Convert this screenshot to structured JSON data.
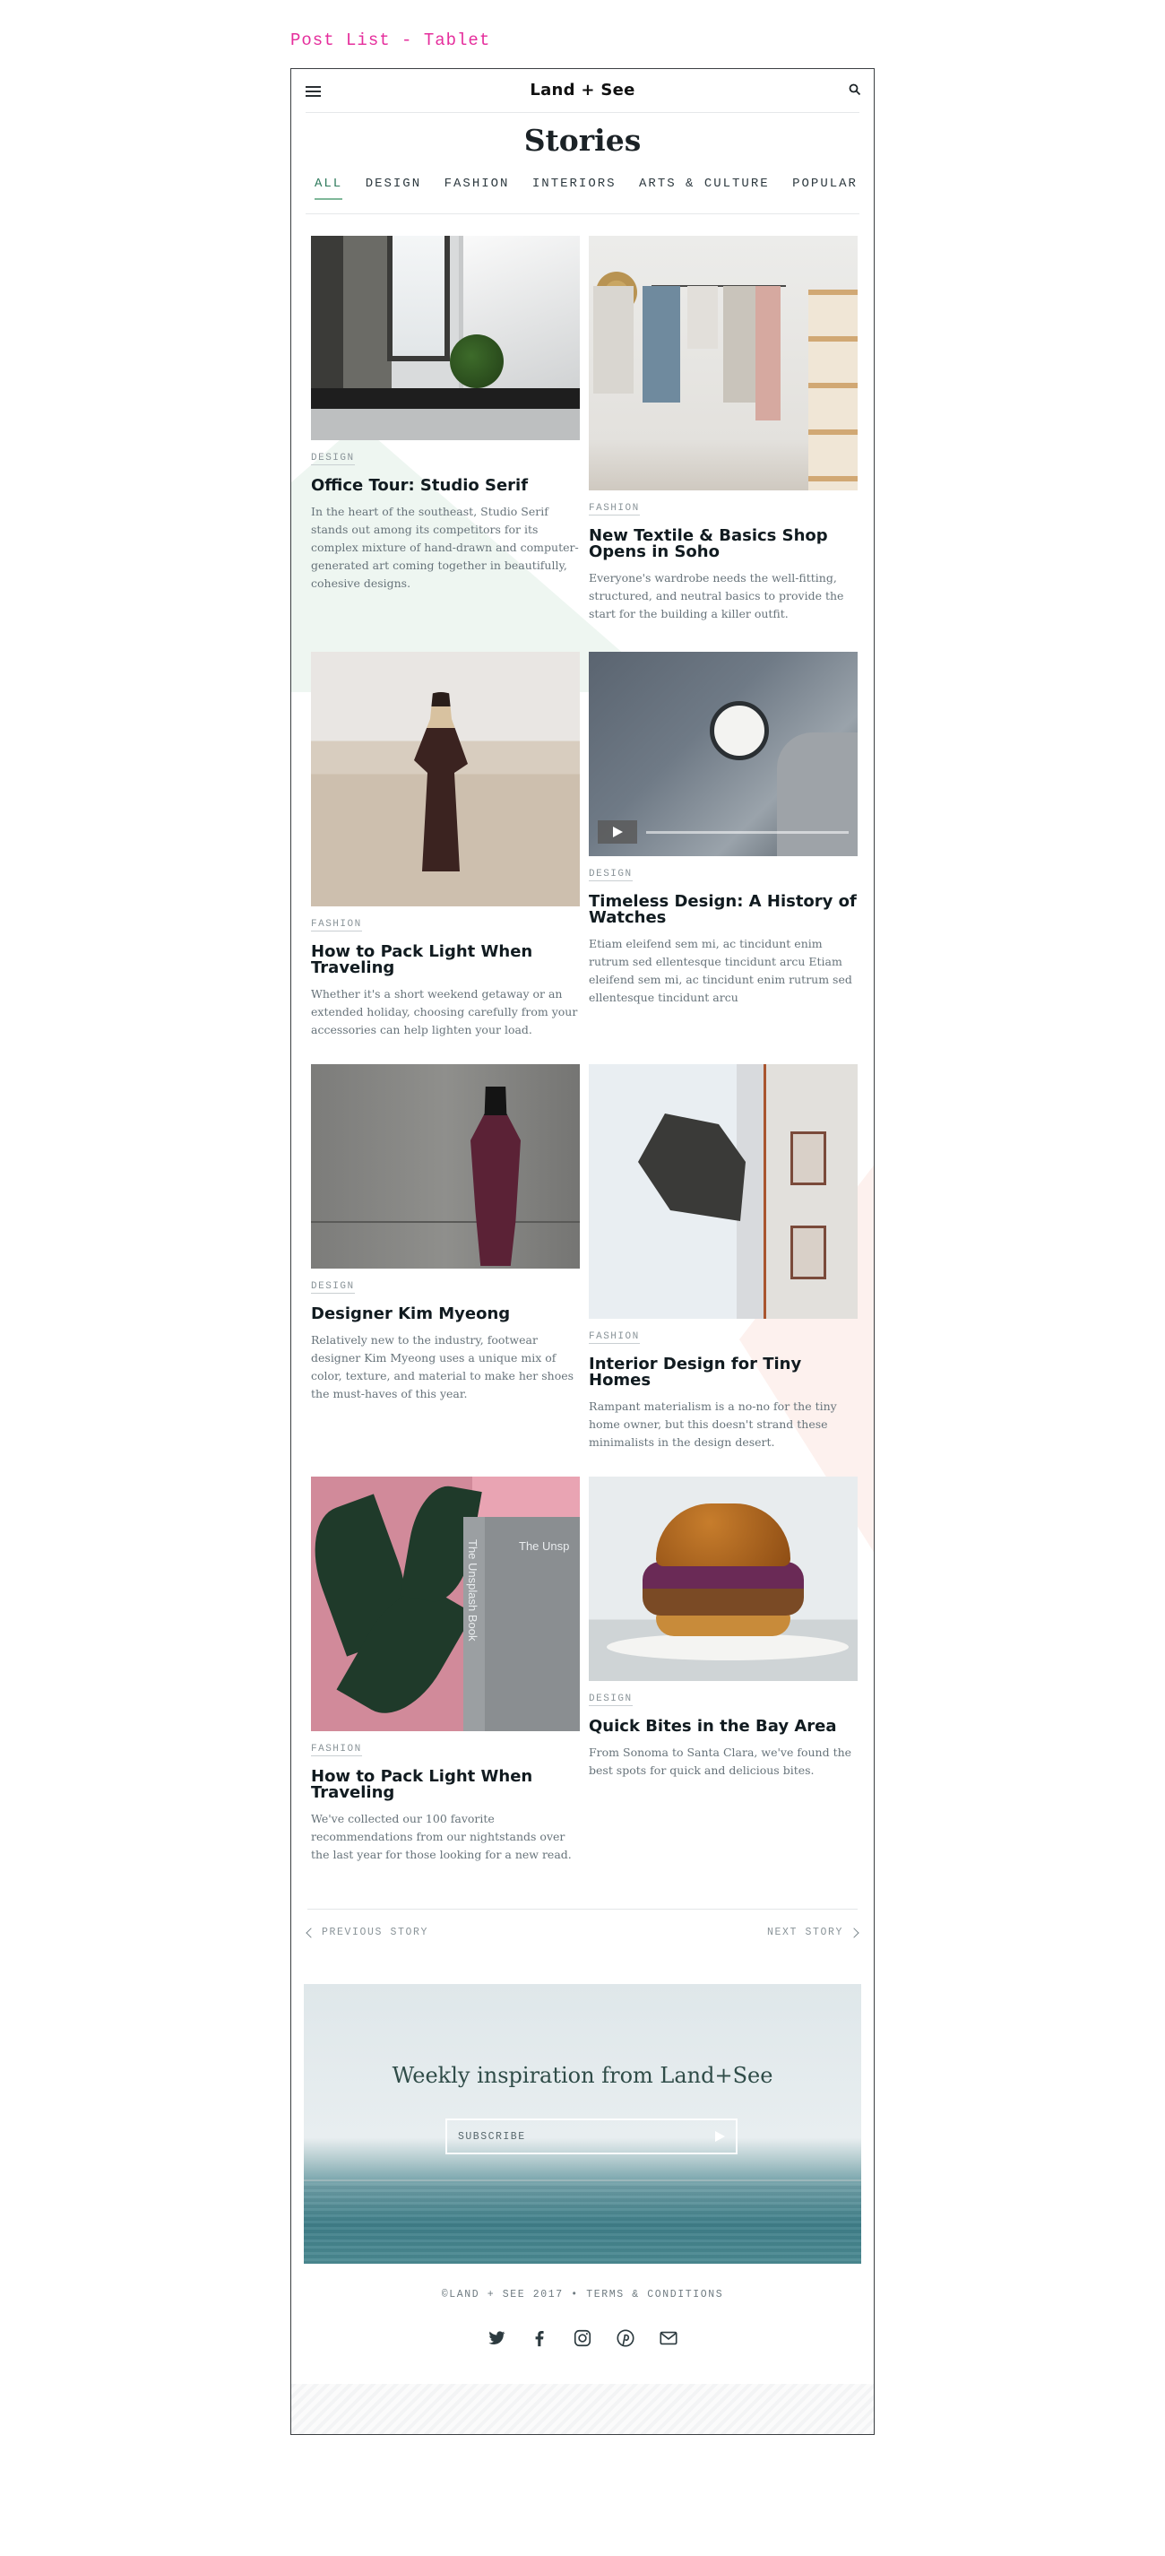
{
  "board_label": "Post List - Tablet",
  "header": {
    "brand": "Land + See",
    "menu_icon": "hamburger-icon",
    "search_icon": "search-icon"
  },
  "page_title": "Stories",
  "tabs": [
    {
      "label": "ALL",
      "active": true
    },
    {
      "label": "DESIGN"
    },
    {
      "label": "FASHION"
    },
    {
      "label": "INTERIORS"
    },
    {
      "label": "ARTS & CULTURE"
    },
    {
      "label": "POPULAR"
    }
  ],
  "posts": [
    {
      "category": "DESIGN",
      "title": "Office Tour: Studio Serif",
      "excerpt": "In the heart of the southeast, Studio Serif stands out among its competitors for its complex mixture of hand-drawn and computer-generated art coming together in beautifully, cohesive designs."
    },
    {
      "category": "FASHION",
      "title": "New Textile & Basics Shop Opens in Soho",
      "excerpt": "Everyone's wardrobe needs the well-fitting, structured, and neutral basics to provide the start for the building a killer outfit."
    },
    {
      "category": "FASHION",
      "title": "How to Pack Light When Traveling",
      "excerpt": "Whether it's a short weekend getaway or an extended holiday, choosing carefully from your accessories can help lighten your load."
    },
    {
      "category": "DESIGN",
      "title": "Timeless Design: A History of Watches",
      "excerpt": "Etiam eleifend sem mi, ac tincidunt enim rutrum sed ellentesque tincidunt arcu Etiam eleifend sem mi, ac tincidunt enim rutrum sed ellentesque tincidunt arcu"
    },
    {
      "category": "DESIGN",
      "title": "Designer Kim Myeong",
      "excerpt": "Relatively new to the industry, footwear designer Kim Myeong uses a unique mix of color, texture, and material to make her shoes the must-haves of this year."
    },
    {
      "category": "FASHION",
      "title": "Interior Design for Tiny Homes",
      "excerpt": "Rampant materialism is a no-no for the tiny home owner, but this doesn't strand these minimalists in the design desert."
    },
    {
      "category": "FASHION",
      "title": "How to Pack Light When Traveling",
      "excerpt": "We've collected our 100 favorite recommendations from our nightstands over the last year for those looking for a new read.",
      "book_cover": "The Unsp",
      "book_spine": "The Unsplash Book"
    },
    {
      "category": "DESIGN",
      "title": "Quick Bites in the Bay Area",
      "excerpt": "From Sonoma to Santa Clara, we've found the best spots for quick and delicious bites."
    }
  ],
  "pager": {
    "prev": "PREVIOUS STORY",
    "next": "NEXT STORY"
  },
  "newsletter": {
    "title": "Weekly inspiration from Land+See",
    "placeholder": "SUBSCRIBE"
  },
  "footer": {
    "copyright": "©LAND + SEE 2017",
    "separator": "•",
    "terms": "TERMS & CONDITIONS",
    "social": [
      "twitter-icon",
      "facebook-icon",
      "instagram-icon",
      "pinterest-icon",
      "mail-icon"
    ]
  },
  "colors": {
    "accent": "#e52e9c",
    "tab_active": "#7fb89a",
    "ink": "#111b20",
    "muted": "#67737a"
  }
}
